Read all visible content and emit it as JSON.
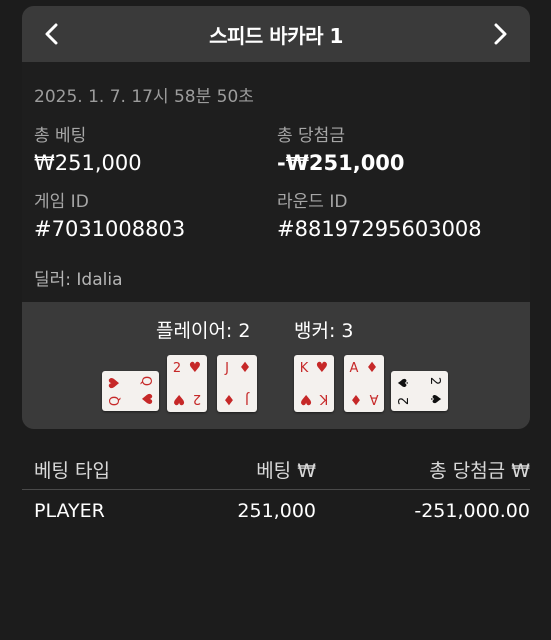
{
  "header": {
    "title": "스피드 바카라 1",
    "prev_icon": "chevron-left-icon",
    "next_icon": "chevron-right-icon"
  },
  "details": {
    "datetime": "2025. 1. 7. 17시 58분 50초",
    "total_bet_label": "총 베팅",
    "total_bet_value": "₩251,000",
    "total_win_label": "총 당첨금",
    "total_win_value": "-₩251,000",
    "game_id_label": "게임 ID",
    "game_id_value": "#7031008803",
    "round_id_label": "라운드 ID",
    "round_id_value": "#88197295603008",
    "dealer": "딜러: Idalia"
  },
  "scores": {
    "player": "플레이어: 2",
    "banker": "뱅커: 3"
  },
  "cards": {
    "player": [
      {
        "rank": "Q",
        "suit": "♥",
        "color": "#c62828",
        "rotated": true
      },
      {
        "rank": "2",
        "suit": "♥",
        "color": "#c62828",
        "rotated": false
      },
      {
        "rank": "J",
        "suit": "♦",
        "color": "#c62828",
        "rotated": false
      }
    ],
    "banker": [
      {
        "rank": "K",
        "suit": "♥",
        "color": "#c62828",
        "rotated": false
      },
      {
        "rank": "A",
        "suit": "♦",
        "color": "#c62828",
        "rotated": false
      },
      {
        "rank": "2",
        "suit": "♠",
        "color": "#111111",
        "rotated": true
      }
    ]
  },
  "table": {
    "headers": [
      "베팅 타입",
      "베팅 ₩",
      "총 당첨금 ₩"
    ],
    "rows": [
      [
        "PLAYER",
        "251,000",
        "-251,000.00"
      ]
    ]
  }
}
